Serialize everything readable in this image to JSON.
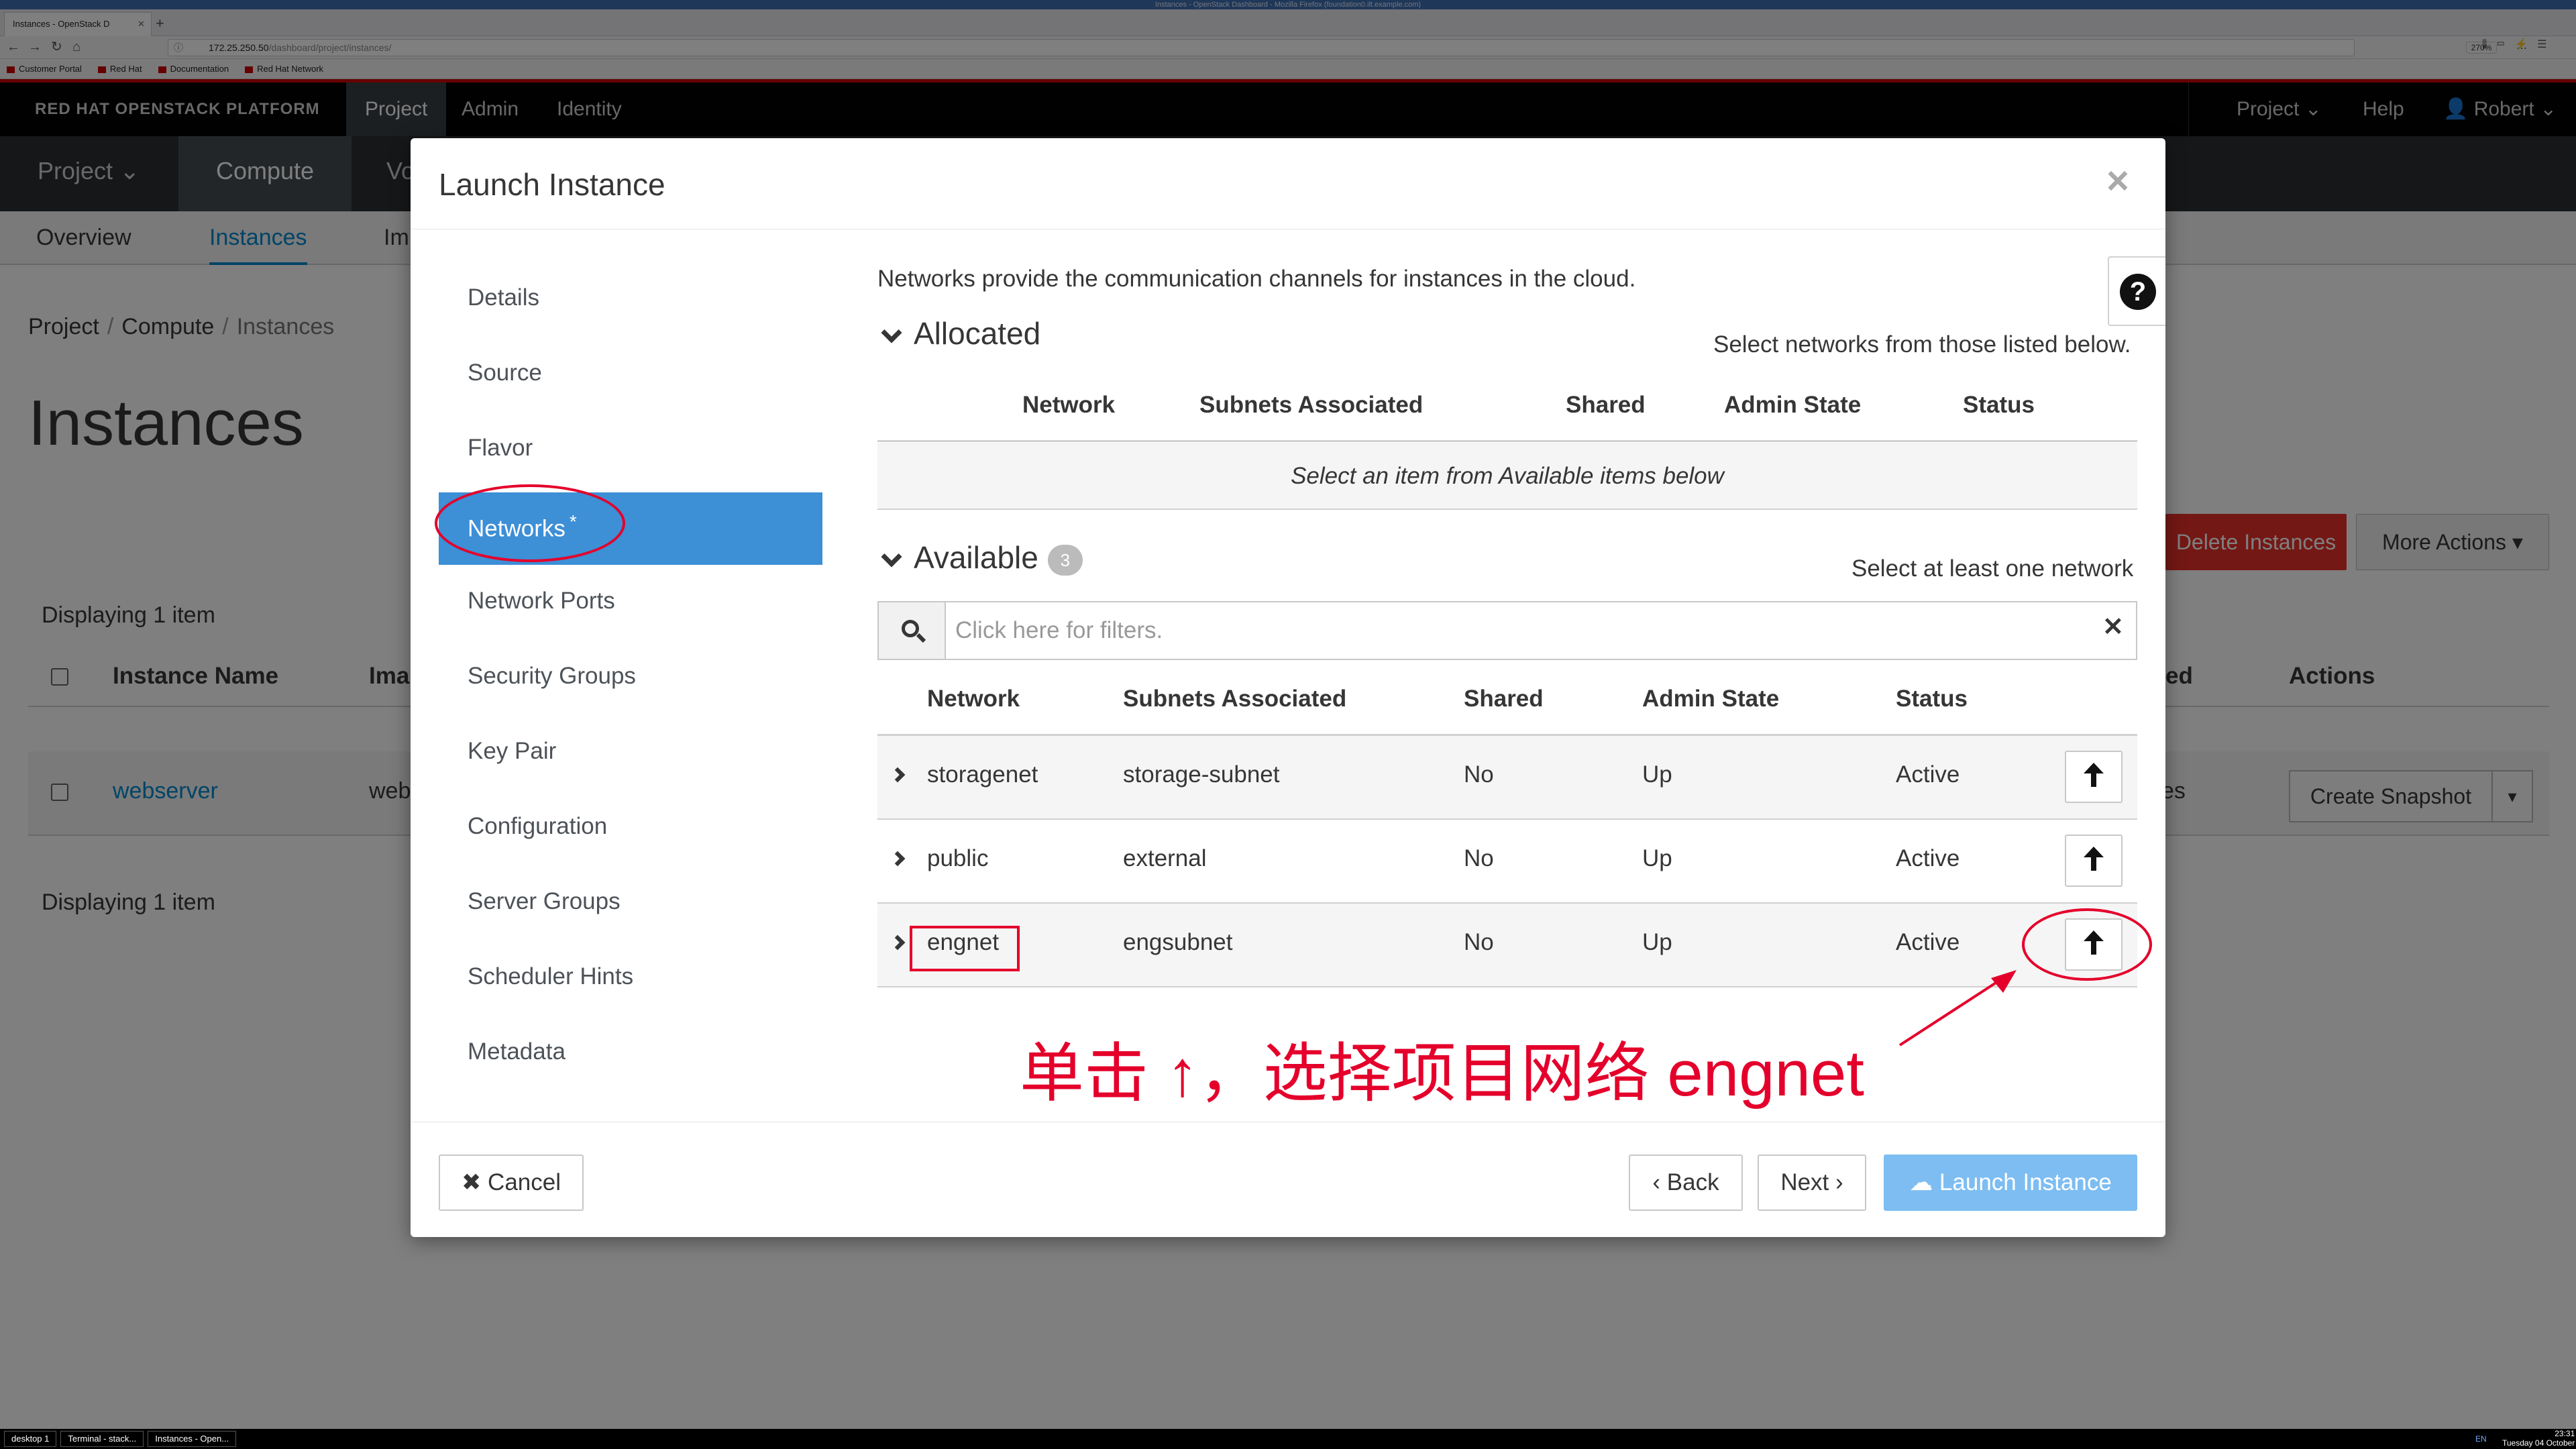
{
  "browser": {
    "window_title": "Instances - OpenStack Dashboard - Mozilla Firefox (foundation0.ilt.example.com)",
    "tab_title": "Instances - OpenStack D",
    "url_host": "172.25.250.50",
    "url_path": "/dashboard/project/instances/",
    "zoom": "270%",
    "bookmarks": [
      "Customer Portal",
      "Red Hat",
      "Documentation",
      "Red Hat Network"
    ]
  },
  "topnav": {
    "brand": "RED HAT OPENSTACK PLATFORM",
    "items": [
      "Project",
      "Admin",
      "Identity"
    ],
    "right": {
      "project": "Project",
      "help": "Help",
      "user": "Robert"
    }
  },
  "secnav": {
    "items": [
      "Project",
      "Compute",
      "Vo"
    ]
  },
  "tabs": {
    "items": [
      "Overview",
      "Instances",
      "Im"
    ]
  },
  "breadcrumb": {
    "items": [
      "Project",
      "Compute",
      "Instances"
    ]
  },
  "page": {
    "title": "Instances",
    "delete_button": "Delete Instances",
    "more_actions": "More Actions",
    "display_count": "Displaying 1 item",
    "columns": {
      "name": "Instance Name",
      "image": "Ima",
      "clip": "ed",
      "actions": "Actions"
    },
    "row": {
      "name": "webserver",
      "image": "web",
      "clip": "es",
      "action": "Create Snapshot"
    }
  },
  "modal": {
    "title": "Launch Instance",
    "steps": [
      "Details",
      "Source",
      "Flavor",
      "Networks",
      "Network Ports",
      "Security Groups",
      "Key Pair",
      "Configuration",
      "Server Groups",
      "Scheduler Hints",
      "Metadata"
    ],
    "active_step_star": "*",
    "intro": "Networks provide the communication channels for instances in the cloud.",
    "allocated": {
      "title": "Allocated",
      "hint": "Select networks from those listed below.",
      "columns": [
        "Network",
        "Subnets Associated",
        "Shared",
        "Admin State",
        "Status"
      ],
      "empty_text": "Select an item from Available items below"
    },
    "available": {
      "title": "Available",
      "count": "3",
      "hint": "Select at least one network",
      "filter_placeholder": "Click here for filters.",
      "columns": [
        "Network",
        "Subnets Associated",
        "Shared",
        "Admin State",
        "Status"
      ],
      "rows": [
        {
          "network": "storagenet",
          "subnet": "storage-subnet",
          "shared": "No",
          "admin_state": "Up",
          "status": "Active"
        },
        {
          "network": "public",
          "subnet": "external",
          "shared": "No",
          "admin_state": "Up",
          "status": "Active"
        },
        {
          "network": "engnet",
          "subnet": "engsubnet",
          "shared": "No",
          "admin_state": "Up",
          "status": "Active"
        }
      ]
    },
    "footer": {
      "cancel": "Cancel",
      "back": "Back",
      "next": "Next",
      "launch": "Launch Instance"
    }
  },
  "annotation": {
    "text": "单击 ↑，选择项目网络 engnet",
    "color": "#e4002b"
  },
  "taskbar": {
    "items": [
      "desktop 1",
      "Terminal - stack...",
      "Instances - Open..."
    ],
    "lang": "EN",
    "time": "23:31",
    "date": "Tuesday 04 October"
  },
  "colors": {
    "accent": "#0088ce",
    "active_step": "#3d8fd6",
    "launch_disabled": "#7dbdf2",
    "danger": "#e8312a",
    "annotation": "#e4002b"
  }
}
